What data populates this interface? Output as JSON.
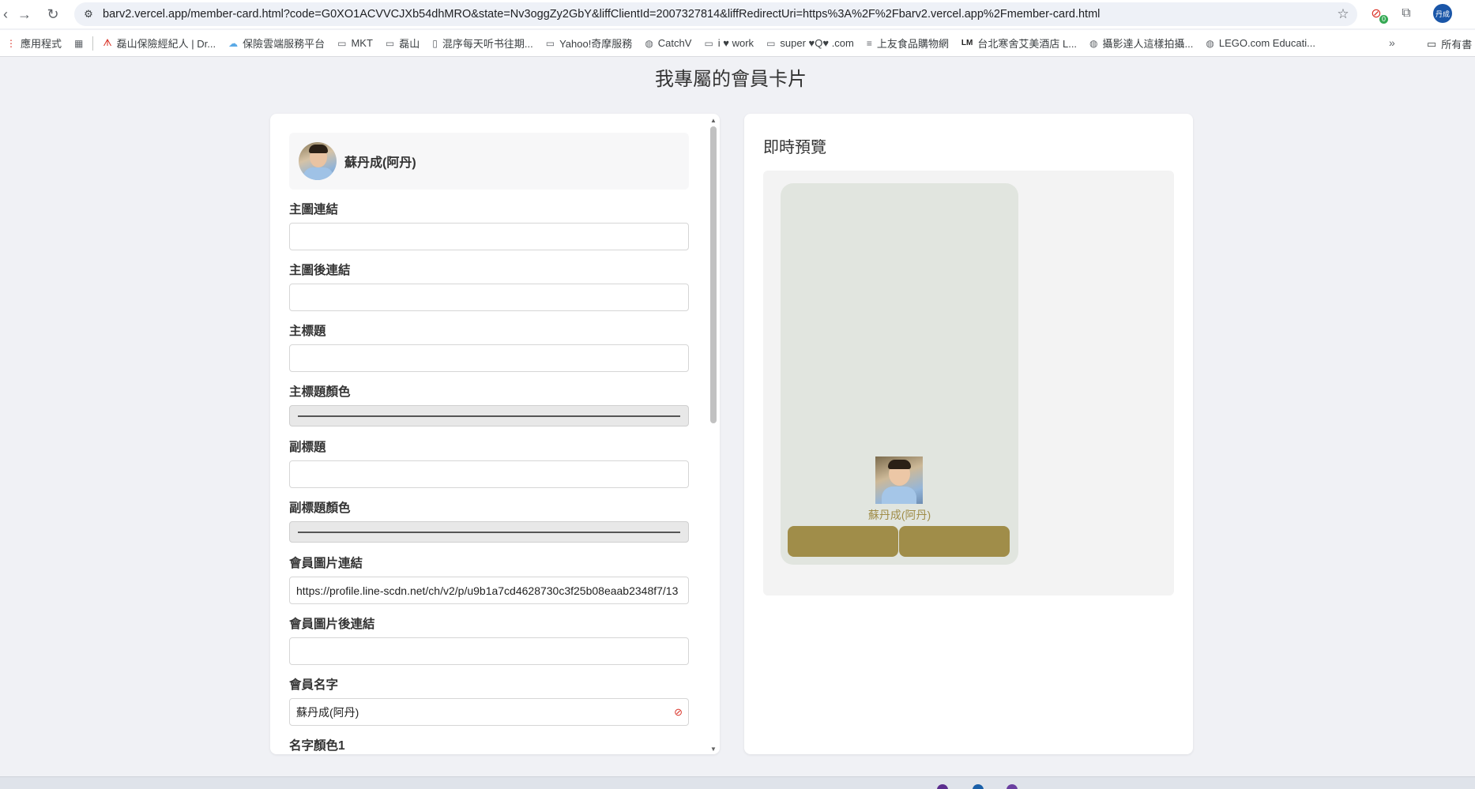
{
  "browser": {
    "url": "barv2.vercel.app/member-card.html?code=G0XO1ACVVCJXb54dhMRO&state=Nv3oggZy2GbY&liffClientId=2007327814&liffRedirectUri=https%3A%2F%2Fbarv2.vercel.app%2Fmember-card.html",
    "extension_count": "0",
    "profile_label": "丹成",
    "icons": {
      "back": "back-arrow-icon",
      "forward": "forward-arrow-icon",
      "reload": "reload-icon",
      "site_info": "site-info-icon",
      "star": "star-icon",
      "puzzle": "extensions-icon"
    }
  },
  "bookmarks": {
    "items": [
      {
        "label": "應用程式",
        "icon": "apps-icon"
      },
      {
        "label": "",
        "icon": "grid-icon"
      },
      {
        "label": "磊山保險經紀人 | Dr...",
        "icon": "red-logo-icon"
      },
      {
        "label": "保險雲端服務平台",
        "icon": "cloud-icon"
      },
      {
        "label": "MKT",
        "icon": "folder-icon"
      },
      {
        "label": "磊山",
        "icon": "folder-icon"
      },
      {
        "label": "混序每天听书往期...",
        "icon": "doc-icon"
      },
      {
        "label": "Yahoo!奇摩服務",
        "icon": "folder-icon"
      },
      {
        "label": "CatchV",
        "icon": "globe-icon"
      },
      {
        "label": "i ♥ work",
        "icon": "folder-icon"
      },
      {
        "label": "super ♥Q♥ .com",
        "icon": "folder-icon"
      },
      {
        "label": "上友食品購物網",
        "icon": "shop-icon"
      },
      {
        "label": "台北寒舍艾美酒店 L...",
        "icon": "lm-icon"
      },
      {
        "label": "攝影達人這樣拍攝...",
        "icon": "globe-icon"
      },
      {
        "label": "LEGO.com Educati...",
        "icon": "globe-icon"
      }
    ],
    "more_label": "»",
    "all_label": "所有書"
  },
  "page": {
    "title": "我專屬的會員卡片"
  },
  "editor": {
    "user_name": "蘇丹成(阿丹)",
    "fields": {
      "main_image_link": {
        "label": "主圖連結",
        "value": ""
      },
      "main_image_after_link": {
        "label": "主圖後連結",
        "value": ""
      },
      "main_title": {
        "label": "主標題",
        "value": ""
      },
      "main_title_color": {
        "label": "主標題顏色"
      },
      "subtitle": {
        "label": "副標題",
        "value": ""
      },
      "subtitle_color": {
        "label": "副標題顏色"
      },
      "member_image_link": {
        "label": "會員圖片連結",
        "value": "https://profile.line-scdn.net/ch/v2/p/u9b1a7cd4628730c3f25b08eaab2348f7/13"
      },
      "member_image_after_link": {
        "label": "會員圖片後連結",
        "value": ""
      },
      "member_name": {
        "label": "會員名字",
        "value": "蘇丹成(阿丹)"
      },
      "name_color_1": {
        "label": "名字顏色1"
      }
    }
  },
  "preview": {
    "title": "即時預覽",
    "card_name": "蘇丹成(阿丹)",
    "card_bg_color": "#e1e5df",
    "accent_color": "#a08d49"
  }
}
